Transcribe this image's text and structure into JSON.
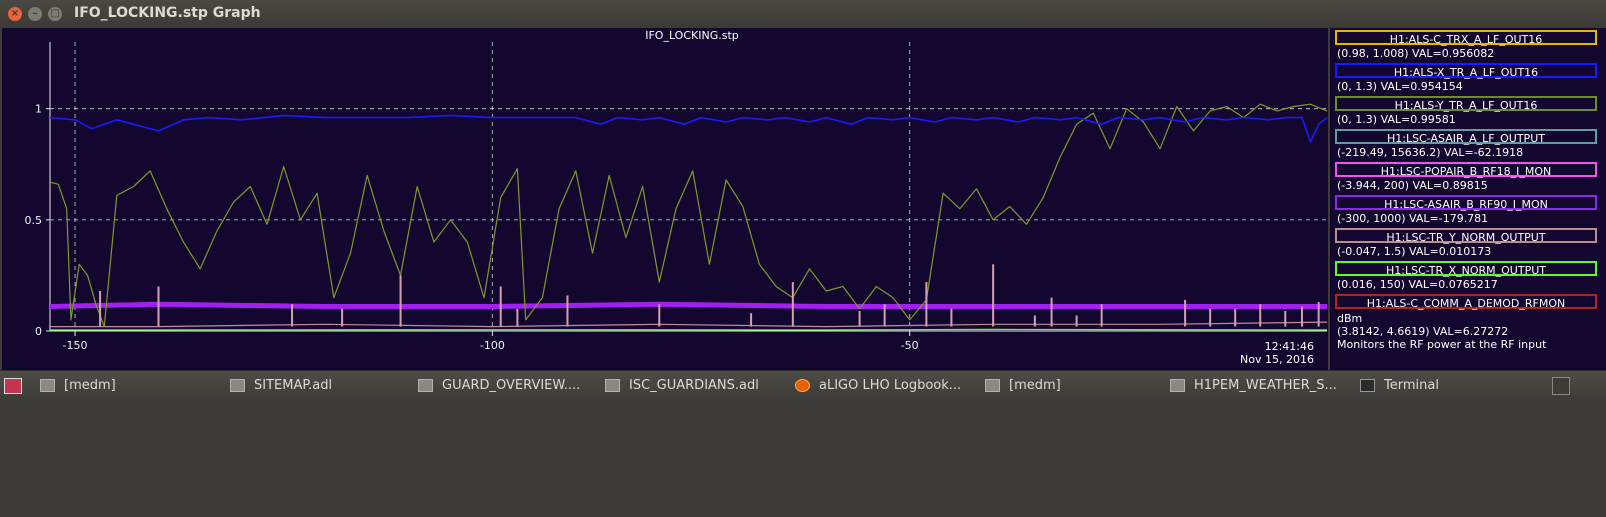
{
  "window": {
    "title": "IFO_LOCKING.stp Graph",
    "buttons": [
      "close",
      "minimize",
      "maximize"
    ]
  },
  "chart_data": {
    "type": "line",
    "title": "IFO_LOCKING.stp",
    "background": "#14072f",
    "grid": true,
    "xlim": [
      -153,
      0
    ],
    "ylim": [
      0,
      1.3
    ],
    "x_ticks": [
      {
        "value": -150,
        "label": "-150"
      },
      {
        "value": -100,
        "label": "-100"
      },
      {
        "value": -50,
        "label": "-50"
      }
    ],
    "y_ticks": [
      {
        "value": 0,
        "label": "0"
      },
      {
        "value": 0.5,
        "label": "0.5"
      },
      {
        "value": 1,
        "label": "1"
      }
    ],
    "time_label": "12:41:46",
    "date_label": "Nov 15, 2016",
    "series": [
      {
        "name": "H1:ALS-X_TR_A_LF_OUT16",
        "color": "#1a1aff",
        "x": [
          -153,
          -150,
          -148,
          -145,
          -143,
          -140,
          -137,
          -134,
          -130,
          -125,
          -120,
          -115,
          -110,
          -105,
          -100,
          -95,
          -90,
          -87,
          -85,
          -82,
          -80,
          -77,
          -75,
          -72,
          -70,
          -67,
          -65,
          -62,
          -60,
          -57,
          -55,
          -52,
          -50,
          -47,
          -45,
          -42,
          -40,
          -37,
          -35,
          -32,
          -30,
          -27,
          -25,
          -22,
          -20,
          -17,
          -15,
          -12,
          -10,
          -7,
          -5,
          -3,
          -2,
          -1,
          0
        ],
        "y": [
          0.96,
          0.95,
          0.91,
          0.95,
          0.93,
          0.9,
          0.95,
          0.96,
          0.95,
          0.97,
          0.96,
          0.96,
          0.96,
          0.97,
          0.96,
          0.96,
          0.96,
          0.93,
          0.96,
          0.95,
          0.96,
          0.93,
          0.96,
          0.94,
          0.96,
          0.95,
          0.96,
          0.94,
          0.96,
          0.93,
          0.96,
          0.95,
          0.96,
          0.94,
          0.96,
          0.95,
          0.96,
          0.94,
          0.96,
          0.95,
          0.96,
          0.93,
          0.96,
          0.95,
          0.96,
          0.94,
          0.96,
          0.95,
          0.96,
          0.95,
          0.96,
          0.96,
          0.85,
          0.93,
          0.96
        ]
      },
      {
        "name": "H1:ALS-Y_TR_A_LF_OUT16",
        "color": "#7f9a2a",
        "x": [
          -153,
          -152,
          -151,
          -150.5,
          -149.5,
          -148.5,
          -147.5,
          -146.5,
          -145,
          -143,
          -141,
          -139,
          -137,
          -135,
          -133,
          -131,
          -129,
          -127,
          -125,
          -123,
          -121,
          -119,
          -117,
          -115,
          -113,
          -111,
          -109,
          -107,
          -105,
          -103,
          -101,
          -99,
          -97,
          -96,
          -94,
          -92,
          -90,
          -88,
          -86,
          -84,
          -82,
          -80,
          -78,
          -76,
          -74,
          -72,
          -70,
          -68,
          -66,
          -64,
          -62,
          -60,
          -58,
          -56,
          -54,
          -52,
          -50,
          -48,
          -46,
          -44,
          -42,
          -40,
          -38,
          -36,
          -34,
          -32,
          -30,
          -28,
          -26,
          -24,
          -22,
          -20,
          -18,
          -16,
          -14,
          -12,
          -10,
          -8,
          -6,
          -4,
          -2,
          0
        ],
        "y": [
          0.67,
          0.66,
          0.55,
          0.05,
          0.3,
          0.25,
          0.12,
          0.02,
          0.61,
          0.65,
          0.72,
          0.55,
          0.4,
          0.28,
          0.45,
          0.58,
          0.65,
          0.48,
          0.74,
          0.5,
          0.62,
          0.15,
          0.35,
          0.7,
          0.45,
          0.25,
          0.65,
          0.4,
          0.5,
          0.4,
          0.15,
          0.6,
          0.73,
          0.05,
          0.15,
          0.55,
          0.72,
          0.35,
          0.7,
          0.42,
          0.65,
          0.22,
          0.55,
          0.72,
          0.3,
          0.68,
          0.56,
          0.3,
          0.2,
          0.15,
          0.28,
          0.18,
          0.2,
          0.1,
          0.2,
          0.15,
          0.05,
          0.14,
          0.62,
          0.55,
          0.64,
          0.5,
          0.56,
          0.48,
          0.6,
          0.78,
          0.93,
          0.98,
          0.82,
          1.0,
          0.94,
          0.82,
          1.01,
          0.9,
          0.99,
          1.01,
          0.96,
          1.02,
          0.99,
          1.01,
          1.02,
          0.99
        ]
      },
      {
        "name": "H1:LSC-ASAIR_B_RF90_I_MON",
        "color": "#a020f0",
        "x": [
          -153,
          -140,
          -120,
          -100,
          -80,
          -60,
          -40,
          -20,
          0
        ],
        "y": [
          0.11,
          0.12,
          0.11,
          0.11,
          0.12,
          0.11,
          0.11,
          0.11,
          0.11
        ]
      },
      {
        "name": "H1:LSC-TR_Y_NORM_OUTPUT",
        "color": "#c08a9a",
        "x": [
          -153,
          -140,
          -120,
          -100,
          -80,
          -60,
          -40,
          -20,
          0
        ],
        "y": [
          0.02,
          0.02,
          0.03,
          0.02,
          0.03,
          0.02,
          0.03,
          0.03,
          0.04
        ]
      },
      {
        "name": "H1:LSC-TR_X_NORM_OUTPUT",
        "color": "#55ff22",
        "x": [
          -153,
          -100,
          -60,
          -40,
          0
        ],
        "y": [
          0.005,
          0.006,
          0.005,
          0.007,
          0.005
        ]
      }
    ],
    "spikes": {
      "name": "H1:LSC-TR_Y_NORM_OUTPUT",
      "color": "#d4a0b4",
      "x": [
        -147,
        -140,
        -124,
        -118,
        -111,
        -99,
        -97,
        -91,
        -80,
        -69,
        -64,
        -56,
        -53,
        -48,
        -45,
        -40,
        -35,
        -33,
        -30,
        -27,
        -17,
        -14,
        -11,
        -8,
        -5,
        -3,
        -1
      ],
      "y": [
        0.18,
        0.2,
        0.12,
        0.1,
        0.25,
        0.2,
        0.1,
        0.16,
        0.12,
        0.08,
        0.22,
        0.09,
        0.12,
        0.22,
        0.1,
        0.3,
        0.07,
        0.15,
        0.07,
        0.12,
        0.14,
        0.1,
        0.1,
        0.12,
        0.09,
        0.11,
        0.13
      ]
    }
  },
  "legend": {
    "items": [
      {
        "channel": "H1:ALS-C_TRX_A_LF_OUT16",
        "range": "(0.98, 1.008) VAL=0.956082",
        "color": "#e6b800"
      },
      {
        "channel": "H1:ALS-X_TR_A_LF_OUT16",
        "range": "(0, 1.3) VAL=0.954154",
        "color": "#1a1aff"
      },
      {
        "channel": "H1:ALS-Y_TR_A_LF_OUT16",
        "range": "(0, 1.3) VAL=0.99581",
        "color": "#6b8e23"
      },
      {
        "channel": "H1:LSC-ASAIR_A_LF_OUTPUT",
        "range": "(-219.49, 15636.2) VAL=-62.1918",
        "color": "#5f9ea0"
      },
      {
        "channel": "H1:LSC-POPAIR_B_RF18_I_MON",
        "range": "(-3.944, 200) VAL=0.89815",
        "color": "#ee55ee"
      },
      {
        "channel": "H1:LSC-ASAIR_B_RF90_I_MON",
        "range": "(-300, 1000) VAL=-179.781",
        "color": "#8a2be2"
      },
      {
        "channel": "H1:LSC-TR_Y_NORM_OUTPUT",
        "range": "(-0.047, 1.5) VAL=0.010173",
        "color": "#bc8f8f"
      },
      {
        "channel": "H1:LSC-TR_X_NORM_OUTPUT",
        "range": "(0.016, 150) VAL=0.0765217",
        "color": "#55ff22"
      },
      {
        "channel": "H1:ALS-C_COMM_A_DEMOD_RFMON",
        "range": "",
        "color": "#b22222"
      }
    ],
    "extra_lines": [
      "dBm",
      "(3.8142, 4.6619) VAL=6.27272",
      "Monitors the RF power at the RF input"
    ]
  },
  "taskbar": {
    "items": [
      {
        "label": "[medm]",
        "icon": "window-icon"
      },
      {
        "label": "SITEMAP.adl",
        "icon": "window-icon"
      },
      {
        "label": "GUARD_OVERVIEW....",
        "icon": "window-icon"
      },
      {
        "label": "ISC_GUARDIANS.adl",
        "icon": "window-icon"
      },
      {
        "label": "aLIGO LHO Logbook...",
        "icon": "firefox-icon"
      },
      {
        "label": "[medm]",
        "icon": "window-icon"
      },
      {
        "label": "H1PEM_WEATHER_S...",
        "icon": "window-icon"
      },
      {
        "label": "Terminal",
        "icon": "terminal-icon"
      }
    ]
  }
}
